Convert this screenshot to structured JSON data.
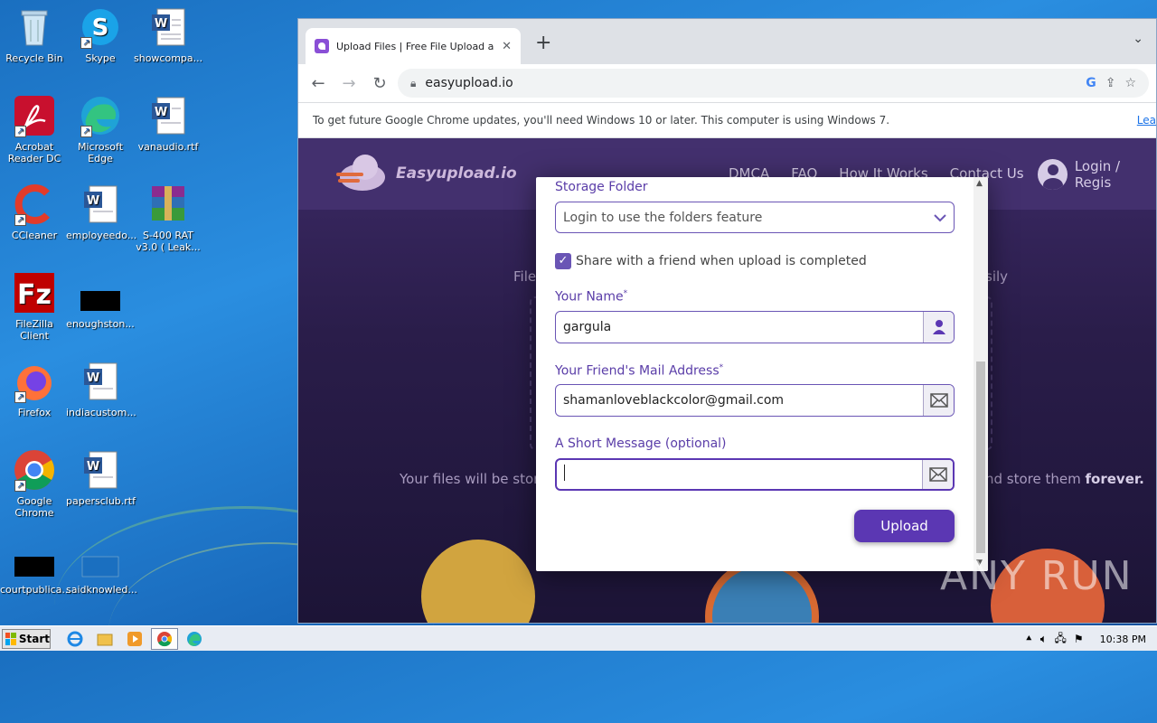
{
  "desktop": {
    "icons": [
      {
        "label": "Recycle Bin"
      },
      {
        "label": "Skype"
      },
      {
        "label": "showcompa..."
      },
      {
        "label": "Acrobat Reader DC"
      },
      {
        "label": "Microsoft Edge"
      },
      {
        "label": "vanaudio.rtf"
      },
      {
        "label": "CCleaner"
      },
      {
        "label": "employeedo..."
      },
      {
        "label": "S-400 RAT v3.0 ( Leak..."
      },
      {
        "label": "FileZilla Client"
      },
      {
        "label": "enoughston..."
      },
      {
        "label": "Firefox"
      },
      {
        "label": "indiacustom..."
      },
      {
        "label": "Google Chrome"
      },
      {
        "label": "papersclub.rtf"
      },
      {
        "label": "courtpublica..."
      },
      {
        "label": "saidknowled..."
      }
    ]
  },
  "browser": {
    "tab_title": "Upload Files | Free File Upload and Tr",
    "url": "easyupload.io",
    "infobar_text": "To get future Google Chrome updates, you'll need Windows 10 or later. This computer is using Windows 7.",
    "infobar_link": "Lea"
  },
  "site": {
    "logo_text": "Easyupload.io",
    "nav": [
      "DMCA",
      "FAQ",
      "How It Works",
      "Contact Us"
    ],
    "login": "Login / Regis",
    "bg_left_frag": "File",
    "bg_right_frag": "sily",
    "bg_stored_left": "Your files will be store",
    "bg_stored_right": "nd store them ",
    "bg_stored_bold": "forever."
  },
  "modal": {
    "storage_folder_label": "Storage Folder",
    "storage_folder_value": "Login to use the folders feature",
    "share_checkbox_label": "Share with a friend when upload is completed",
    "share_checked": true,
    "your_name_label": "Your Name",
    "your_name_value": "gargula",
    "friend_mail_label": "Your Friend's Mail Address",
    "friend_mail_value": "shamanloveblackcolor@gmail.com",
    "message_label": "A Short Message (optional)",
    "message_value": "",
    "upload_button": "Upload",
    "required_mark": "*"
  },
  "taskbar": {
    "start_label": "Start",
    "clock": "10:38 PM"
  },
  "watermark": "ANY RUN",
  "colors": {
    "accent": "#5b37b3",
    "label": "#5a3da8",
    "site_bg": "#2a1d4a"
  }
}
